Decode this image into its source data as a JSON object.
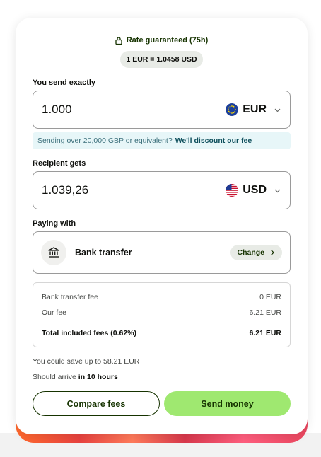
{
  "rate": {
    "guarantee_text": "Rate guaranteed (75h)",
    "exchange_rate": "1 EUR = 1.0458 USD"
  },
  "send": {
    "label": "You send exactly",
    "amount": "1.000",
    "currency": "EUR",
    "flag": "eu-flag-icon"
  },
  "discount": {
    "text": "Sending over 20,000 GBP or equivalent?",
    "link": "We'll discount our fee"
  },
  "receive": {
    "label": "Recipient gets",
    "amount": "1.039,26",
    "currency": "USD",
    "flag": "us-flag-icon"
  },
  "paying": {
    "label": "Paying with",
    "method": "Bank transfer",
    "icon": "bank-icon",
    "change_label": "Change"
  },
  "fees": {
    "rows": [
      {
        "label": "Bank transfer fee",
        "value": "0 EUR"
      },
      {
        "label": "Our fee",
        "value": "6.21 EUR"
      }
    ],
    "total": {
      "label": "Total included fees (0.62%)",
      "value": "6.21 EUR"
    }
  },
  "info": {
    "savings": "You could save up to 58.21 EUR",
    "arrival_prefix": "Should arrive",
    "arrival_time": "in 10 hours"
  },
  "actions": {
    "compare_label": "Compare fees",
    "send_label": "Send money"
  },
  "colors": {
    "primary_green": "#9fe870",
    "dark_green": "#163300",
    "info_bg": "#e7f6f8"
  }
}
